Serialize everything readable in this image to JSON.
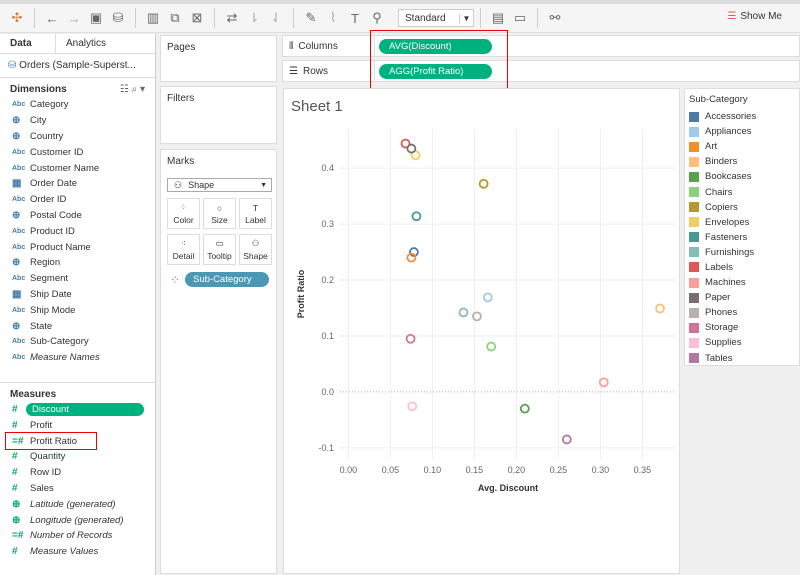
{
  "toolbar": {
    "fit": "Standard",
    "show_me": "Show Me"
  },
  "left": {
    "tab_data": "Data",
    "tab_analytics": "Analytics",
    "datasource": "Orders (Sample-Superst...",
    "dimensions_title": "Dimensions",
    "measures_title": "Measures",
    "dimensions": [
      {
        "label": "Category",
        "icon": "Abc"
      },
      {
        "label": "City",
        "icon": "globe"
      },
      {
        "label": "Country",
        "icon": "globe"
      },
      {
        "label": "Customer ID",
        "icon": "Abc"
      },
      {
        "label": "Customer Name",
        "icon": "Abc"
      },
      {
        "label": "Order Date",
        "icon": "calendar"
      },
      {
        "label": "Order ID",
        "icon": "Abc"
      },
      {
        "label": "Postal Code",
        "icon": "globe"
      },
      {
        "label": "Product ID",
        "icon": "Abc"
      },
      {
        "label": "Product Name",
        "icon": "Abc"
      },
      {
        "label": "Region",
        "icon": "globe"
      },
      {
        "label": "Segment",
        "icon": "Abc"
      },
      {
        "label": "Ship Date",
        "icon": "calendar"
      },
      {
        "label": "Ship Mode",
        "icon": "Abc"
      },
      {
        "label": "State",
        "icon": "globe"
      },
      {
        "label": "Sub-Category",
        "icon": "Abc"
      },
      {
        "label": "Measure Names",
        "icon": "Abc",
        "italic": true
      }
    ],
    "measures": [
      {
        "label": "Discount",
        "icon": "#",
        "highlight": true
      },
      {
        "label": "Profit",
        "icon": "#"
      },
      {
        "label": "Profit Ratio",
        "icon": "=#",
        "boxed": true
      },
      {
        "label": "Quantity",
        "icon": "#"
      },
      {
        "label": "Row ID",
        "icon": "#"
      },
      {
        "label": "Sales",
        "icon": "#"
      },
      {
        "label": "Latitude (generated)",
        "icon": "globe",
        "italic": true
      },
      {
        "label": "Longitude (generated)",
        "icon": "globe",
        "italic": true
      },
      {
        "label": "Number of Records",
        "icon": "=#",
        "italic": true
      },
      {
        "label": "Measure Values",
        "icon": "#",
        "italic": true
      }
    ]
  },
  "cards": {
    "pages": "Pages",
    "filters": "Filters",
    "marks": "Marks",
    "mark_type": "Shape",
    "buttons": [
      "Color",
      "Size",
      "Label",
      "Detail",
      "Tooltip",
      "Shape"
    ],
    "color_pill": "Sub-Category"
  },
  "shelves": {
    "columns_label": "Columns",
    "columns_pill": "AVG(Discount)",
    "rows_label": "Rows",
    "rows_pill": "AGG(Profit Ratio)"
  },
  "sheet": {
    "title": "Sheet 1"
  },
  "chart_data": {
    "type": "scatter",
    "xlabel": "Avg. Discount",
    "ylabel": "Profit Ratio",
    "xlim": [
      -0.01,
      0.39
    ],
    "ylim": [
      -0.12,
      0.47
    ],
    "xticks": [
      "0.00",
      "0.05",
      "0.10",
      "0.15",
      "0.20",
      "0.25",
      "0.30",
      "0.35"
    ],
    "yticks": [
      "-0.1",
      "0.0",
      "0.1",
      "0.2",
      "0.3",
      "0.4"
    ],
    "legend_title": "Sub-Category",
    "legend_position": "right",
    "points": [
      {
        "name": "Accessories",
        "color": "#4e79a7",
        "x": 0.078,
        "y": 0.25
      },
      {
        "name": "Appliances",
        "color": "#a0cbe8",
        "x": 0.166,
        "y": 0.169
      },
      {
        "name": "Art",
        "color": "#f28e2b",
        "x": 0.075,
        "y": 0.24
      },
      {
        "name": "Binders",
        "color": "#ffbe7d",
        "x": 0.371,
        "y": 0.149
      },
      {
        "name": "Bookcases",
        "color": "#59a14f",
        "x": 0.21,
        "y": -0.03
      },
      {
        "name": "Chairs",
        "color": "#8cd17d",
        "x": 0.17,
        "y": 0.081
      },
      {
        "name": "Copiers",
        "color": "#b6992d",
        "x": 0.161,
        "y": 0.372
      },
      {
        "name": "Envelopes",
        "color": "#f1ce63",
        "x": 0.08,
        "y": 0.423
      },
      {
        "name": "Fasteners",
        "color": "#499894",
        "x": 0.081,
        "y": 0.314
      },
      {
        "name": "Furnishings",
        "color": "#86bcb6",
        "x": 0.137,
        "y": 0.142
      },
      {
        "name": "Labels",
        "color": "#e15759",
        "x": 0.068,
        "y": 0.444
      },
      {
        "name": "Machines",
        "color": "#ff9d9a",
        "x": 0.304,
        "y": 0.017
      },
      {
        "name": "Paper",
        "color": "#79706e",
        "x": 0.075,
        "y": 0.435
      },
      {
        "name": "Phones",
        "color": "#bab0ac",
        "x": 0.153,
        "y": 0.135
      },
      {
        "name": "Storage",
        "color": "#d37295",
        "x": 0.074,
        "y": 0.095
      },
      {
        "name": "Supplies",
        "color": "#fabfd2",
        "x": 0.076,
        "y": -0.026
      },
      {
        "name": "Tables",
        "color": "#b07aa1",
        "x": 0.26,
        "y": -0.085
      }
    ]
  }
}
